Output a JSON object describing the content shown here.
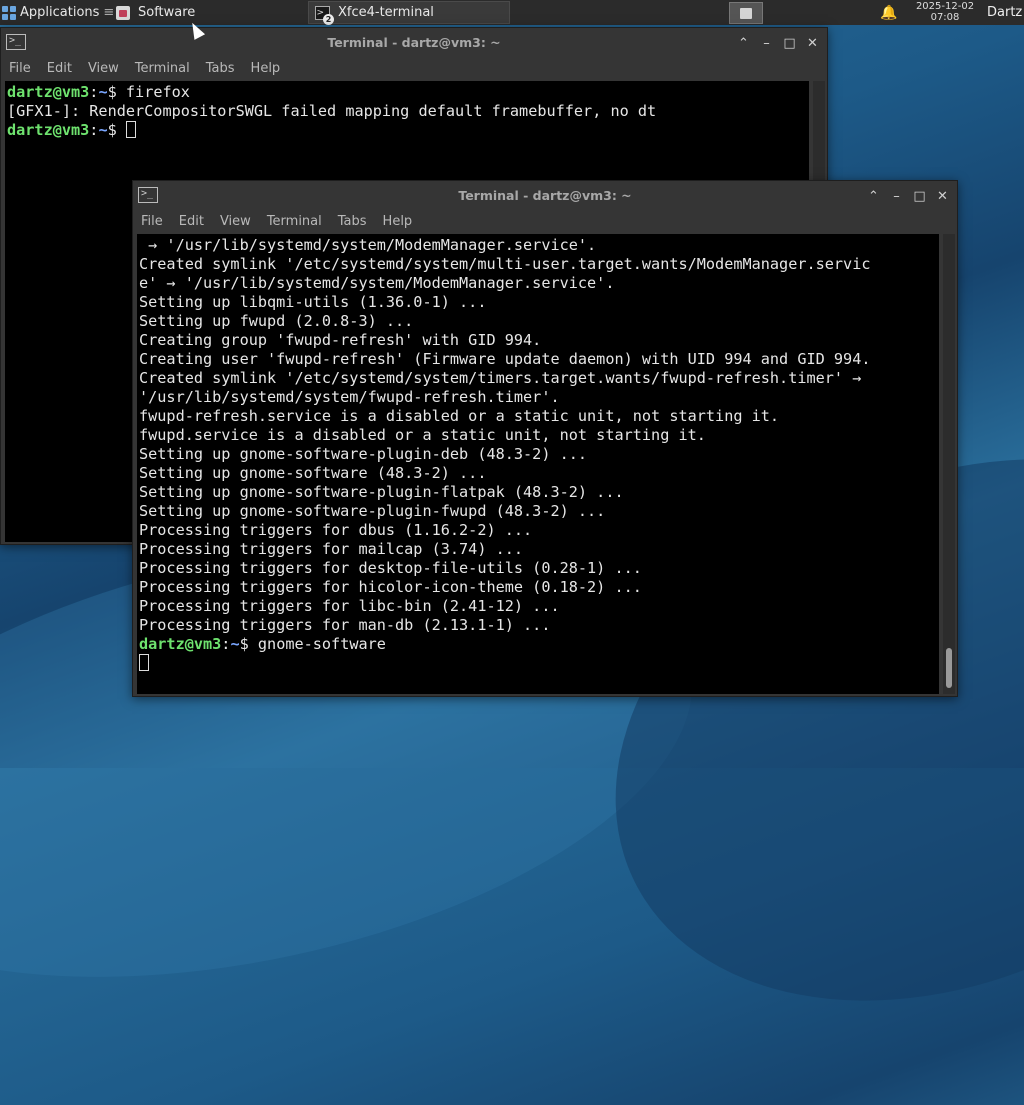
{
  "panel": {
    "applications_label": "Applications",
    "tasks": [
      {
        "label": "Software",
        "icon": "software-center-icon"
      },
      {
        "label": "Xfce4-terminal",
        "icon": "terminal-icon",
        "badge": "2"
      }
    ],
    "clock_date": "2025-12-02",
    "clock_time": "07:08",
    "user": "Dartz"
  },
  "window_back": {
    "title": "Terminal - dartz@vm3: ~",
    "menu": [
      "File",
      "Edit",
      "View",
      "Terminal",
      "Tabs",
      "Help"
    ],
    "prompt_user": "dartz@vm3",
    "prompt_sep": ":",
    "prompt_path": "~",
    "prompt_sym": "$",
    "cmd1": " firefox",
    "output1": "[GFX1-]: RenderCompositorSWGL failed mapping default framebuffer, no dt"
  },
  "window_front": {
    "title": "Terminal - dartz@vm3: ~",
    "menu": [
      "File",
      "Edit",
      "View",
      "Terminal",
      "Tabs",
      "Help"
    ],
    "lines": [
      " → '/usr/lib/systemd/system/ModemManager.service'.",
      "Created symlink '/etc/systemd/system/multi-user.target.wants/ModemManager.servic",
      "e' → '/usr/lib/systemd/system/ModemManager.service'.",
      "Setting up libqmi-utils (1.36.0-1) ...",
      "Setting up fwupd (2.0.8-3) ...",
      "Creating group 'fwupd-refresh' with GID 994.",
      "Creating user 'fwupd-refresh' (Firmware update daemon) with UID 994 and GID 994.",
      "Created symlink '/etc/systemd/system/timers.target.wants/fwupd-refresh.timer' →",
      "'/usr/lib/systemd/system/fwupd-refresh.timer'.",
      "fwupd-refresh.service is a disabled or a static unit, not starting it.",
      "fwupd.service is a disabled or a static unit, not starting it.",
      "Setting up gnome-software-plugin-deb (48.3-2) ...",
      "Setting up gnome-software (48.3-2) ...",
      "Setting up gnome-software-plugin-flatpak (48.3-2) ...",
      "Setting up gnome-software-plugin-fwupd (48.3-2) ...",
      "Processing triggers for dbus (1.16.2-2) ...",
      "Processing triggers for mailcap (3.74) ...",
      "Processing triggers for desktop-file-utils (0.28-1) ...",
      "Processing triggers for hicolor-icon-theme (0.18-2) ...",
      "Processing triggers for libc-bin (2.41-12) ...",
      "Processing triggers for man-db (2.13.1-1) ..."
    ],
    "prompt_user": "dartz@vm3",
    "prompt_sep": ":",
    "prompt_path": "~",
    "prompt_sym": "$",
    "last_cmd": " gnome-software"
  }
}
